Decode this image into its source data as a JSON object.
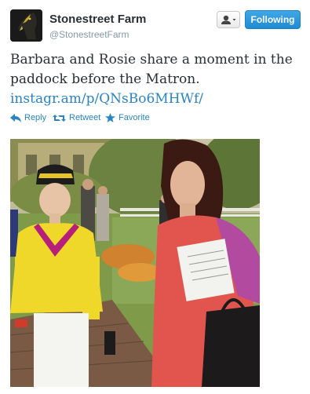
{
  "account": {
    "display_name": "Stonestreet Farm",
    "screen_name": "@StonestreetFarm"
  },
  "header": {
    "follow_label": "Following"
  },
  "tweet": {
    "text_line1": "Barbara and Rosie share a moment in the",
    "text_line2": "paddock before the Matron.",
    "link_text": "instagr.am/p/QNsBo6MHWf/"
  },
  "actions": {
    "reply_label": "Reply",
    "retweet_label": "Retweet",
    "favorite_label": "Favorite"
  },
  "icons": {
    "user_dropdown": "person-icon",
    "reply": "reply-arrow-icon",
    "retweet": "retweet-icon",
    "favorite": "star-icon"
  },
  "colors": {
    "link_blue": "#2a84c3",
    "follow_button": "#2a96dc",
    "name_text": "#292f33",
    "handle_text": "#8899a6"
  }
}
